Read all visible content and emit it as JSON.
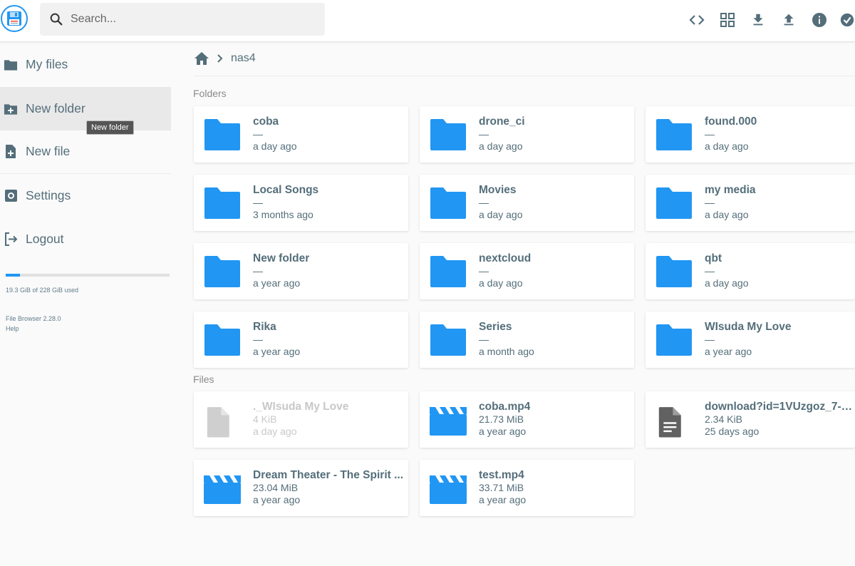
{
  "header": {
    "search_placeholder": "Search...",
    "accent": "#2196f3",
    "actions": [
      "code-icon",
      "grid-view-icon",
      "download-icon",
      "upload-icon",
      "info-icon",
      "check-circle-icon"
    ]
  },
  "sidebar": {
    "items": [
      {
        "label": "My files",
        "icon": "folder-icon"
      },
      {
        "label": "New folder",
        "icon": "create-folder-icon"
      },
      {
        "label": "New file",
        "icon": "note-add-icon"
      },
      {
        "label": "Settings",
        "icon": "settings-icon"
      },
      {
        "label": "Logout",
        "icon": "logout-icon"
      }
    ],
    "tooltip": "New folder",
    "usage_text": "19.3 GiB of 228 GiB used",
    "usage_fraction": 0.085,
    "version": "File Browser 2.28.0",
    "help": "Help"
  },
  "breadcrumb": {
    "current": "nas4"
  },
  "sections": {
    "folders": "Folders",
    "files": "Files"
  },
  "folders": [
    {
      "name": "coba",
      "size": "—",
      "modified": "a day ago"
    },
    {
      "name": "drone_ci",
      "size": "—",
      "modified": "a day ago"
    },
    {
      "name": "found.000",
      "size": "—",
      "modified": "a day ago"
    },
    {
      "name": "Local Songs",
      "size": "—",
      "modified": "3 months ago"
    },
    {
      "name": "Movies",
      "size": "—",
      "modified": "a day ago"
    },
    {
      "name": "my media",
      "size": "—",
      "modified": "a day ago"
    },
    {
      "name": "New folder",
      "size": "—",
      "modified": "a year ago"
    },
    {
      "name": "nextcloud",
      "size": "—",
      "modified": "a day ago"
    },
    {
      "name": "qbt",
      "size": "—",
      "modified": "a day ago"
    },
    {
      "name": "Rika",
      "size": "—",
      "modified": "a year ago"
    },
    {
      "name": "Series",
      "size": "—",
      "modified": "a month ago"
    },
    {
      "name": "WIsuda My Love",
      "size": "—",
      "modified": "a year ago"
    }
  ],
  "files": [
    {
      "name": "._WIsuda My Love",
      "size": "4 KiB",
      "modified": "a day ago",
      "icon": "blank-file-icon"
    },
    {
      "name": "coba.mp4",
      "size": "21.73 MiB",
      "modified": "a year ago",
      "icon": "video-file-icon"
    },
    {
      "name": "download?id=1VUzgoz_7-1...",
      "size": "2.34 KiB",
      "modified": "25 days ago",
      "icon": "text-file-icon"
    },
    {
      "name": "Dream Theater - The Spirit ...",
      "size": "23.04 MiB",
      "modified": "a year ago",
      "icon": "video-file-icon"
    },
    {
      "name": "test.mp4",
      "size": "33.71 MiB",
      "modified": "a year ago",
      "icon": "video-file-icon"
    }
  ]
}
